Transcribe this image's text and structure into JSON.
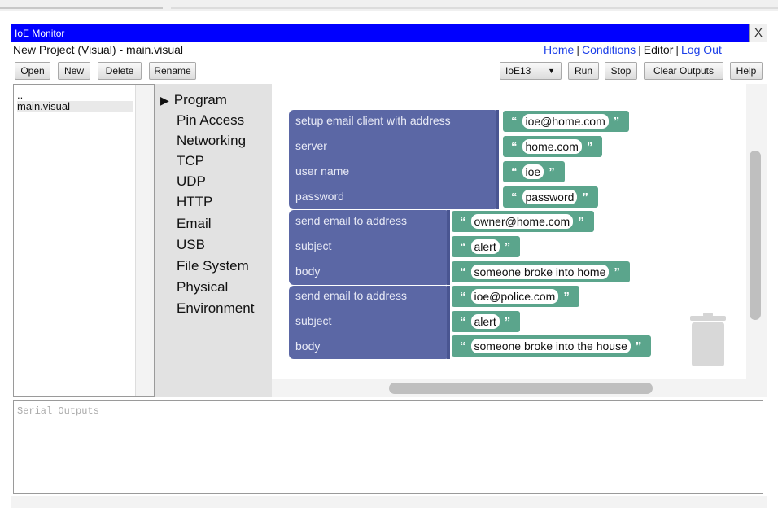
{
  "window": {
    "title": "IoE Monitor",
    "close": "X"
  },
  "project_line": "New Project (Visual) - main.visual",
  "nav": {
    "home": "Home",
    "conditions": "Conditions",
    "editor": "Editor",
    "logout": "Log Out",
    "sep": "|"
  },
  "toolbar": {
    "open": "Open",
    "new": "New",
    "delete": "Delete",
    "rename": "Rename",
    "device": "IoE13",
    "run": "Run",
    "stop": "Stop",
    "clear": "Clear Outputs",
    "help": "Help"
  },
  "files": [
    "..",
    "main.visual"
  ],
  "categories": [
    "Program",
    "Pin Access",
    "Networking",
    "TCP",
    "UDP",
    "HTTP",
    "Email",
    "USB",
    "File System",
    "Physical",
    "Environment"
  ],
  "blocks": {
    "setup": {
      "label": "setup email client with address",
      "address": "ioe@home.com",
      "server_label": "server",
      "server": "home.com",
      "user_label": "user name",
      "user": "ioe",
      "password_label": "password",
      "password": "password"
    },
    "send1": {
      "label": "send email to address",
      "address": "owner@home.com",
      "subject_label": "subject",
      "subject": "alert",
      "body_label": "body",
      "body": "someone broke into home"
    },
    "send2": {
      "label": "send email to address",
      "address": "ioe@police.com",
      "subject_label": "subject",
      "subject": "alert",
      "body_label": "body",
      "body": "someone broke into the house"
    }
  },
  "quote_open": "“",
  "quote_close": "”",
  "serial": {
    "placeholder": "Serial Outputs"
  },
  "colors": {
    "titlebar": "#0000ff",
    "block": "#5b67a5",
    "string": "#5ba58c",
    "links": "#1a3ee8"
  },
  "icons": {
    "play": "play-triangle-icon",
    "dropdown": "chevron-down-icon",
    "trash": "trash-icon"
  }
}
